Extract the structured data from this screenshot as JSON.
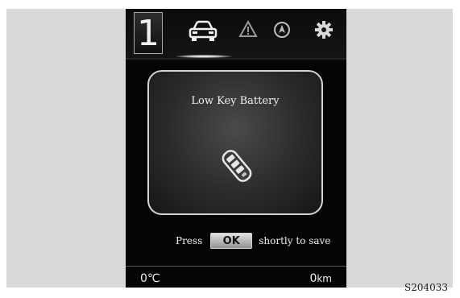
{
  "display": {
    "gear": "1",
    "tabs": [
      {
        "icon": "car-icon",
        "active": true
      },
      {
        "icon": "warning-icon",
        "active": false
      },
      {
        "icon": "navigation-icon",
        "active": false
      },
      {
        "icon": "settings-icon",
        "active": false
      }
    ],
    "message": {
      "title": "Low Key Battery",
      "icon": "key-fob-icon"
    },
    "prompt": {
      "before": "Press",
      "button": "OK",
      "after": "shortly to save"
    },
    "status": {
      "temperature": "0℃",
      "odometer_value": "0",
      "odometer_unit": "km"
    }
  },
  "figure_code": "S204033",
  "colors": {
    "screen_background": "#050505",
    "page_background": "#d9d9d9",
    "text": "#f0f0f0"
  }
}
